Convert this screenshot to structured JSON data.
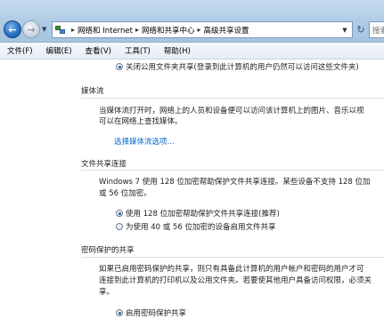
{
  "address": {
    "breadcrumbs": [
      "网络和 Internet",
      "网络和共享中心",
      "高级共享设置"
    ],
    "search_placeholder": "搜索"
  },
  "menu": [
    "文件(F)",
    "编辑(E)",
    "查看(V)",
    "工具(T)",
    "帮助(H)"
  ],
  "public_folder": {
    "option_off": "关闭公用文件夹共享(登录到此计算机的用户仍然可以访问这些文件夹)"
  },
  "media": {
    "title": "媒体流",
    "desc_lines": [
      "当媒体流打开时，网络上的人员和设备便可以访问该计算机上的图片、音乐以视",
      "可以在网络上查找媒体。"
    ],
    "link": "选择媒体流选项..."
  },
  "file_sharing": {
    "title": "文件共享连接",
    "desc_lines": [
      "Windows 7 使用 128 位加密帮助保护文件共享连接。某些设备不支持 128 位加",
      "或 56 位加密。"
    ],
    "option_128": "使用 128 位加密帮助保护文件共享连接(推荐)",
    "option_40_56": "为使用 40 或 56 位加密的设备启用文件共享"
  },
  "password_sharing": {
    "title": "密码保护的共享",
    "desc_lines": [
      "如果已启用密码保护的共享，则只有具备此计算机的用户帐户和密码的用户才可",
      "连接到此计算机的打印机以及公用文件夹。若要使其他用户具备访问权限，必须关",
      "享。"
    ],
    "option_on": "启用密码保护共享"
  }
}
